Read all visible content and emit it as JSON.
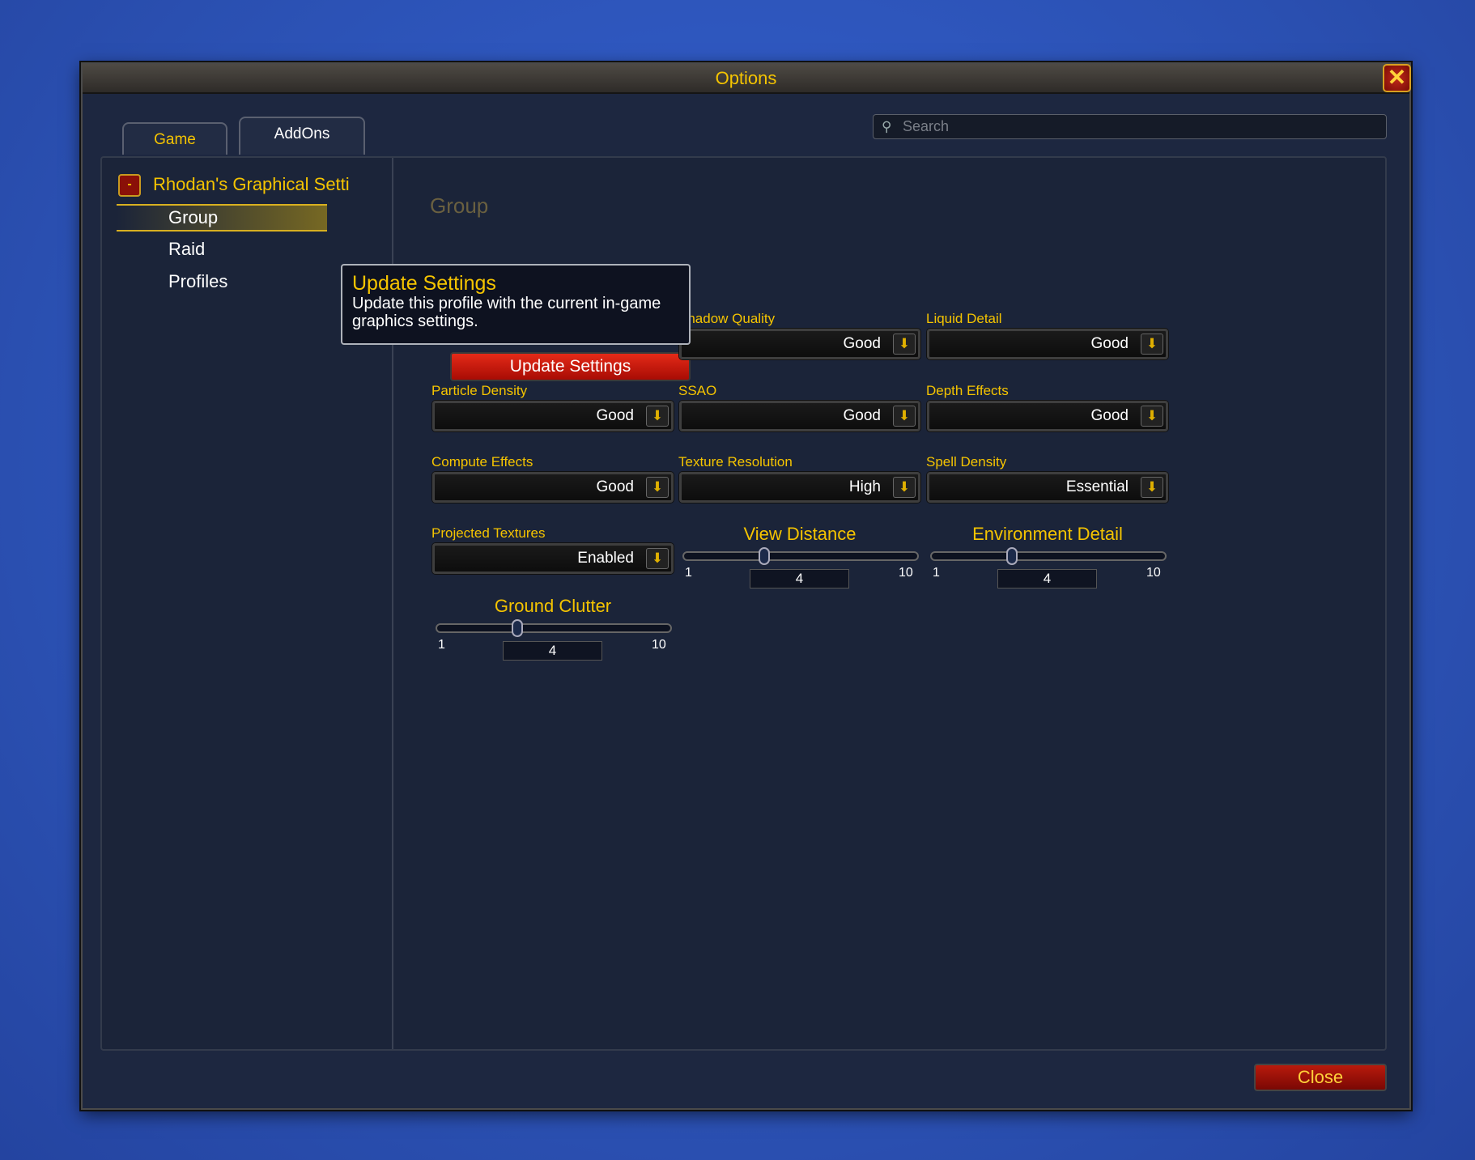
{
  "window": {
    "title": "Options",
    "close_icon": "close-x-icon"
  },
  "tabs": [
    {
      "label": "Game",
      "active": false
    },
    {
      "label": "AddOns",
      "active": true
    }
  ],
  "search": {
    "placeholder": "Search",
    "value": ""
  },
  "sidebar": {
    "root": "Rhodan's Graphical Setti",
    "items": [
      {
        "label": "Group",
        "selected": true
      },
      {
        "label": "Raid"
      },
      {
        "label": "Profiles"
      }
    ]
  },
  "tooltip": {
    "title": "Update Settings",
    "text": "Update this profile with the current in-game graphics settings."
  },
  "section_header": "Group",
  "update_button": "Update Settings",
  "dropdowns": [
    {
      "label": "Shadow Quality",
      "value": "Good"
    },
    {
      "label": "Liquid Detail",
      "value": "Good"
    },
    {
      "label": "Particle Density",
      "value": "Good"
    },
    {
      "label": "SSAO",
      "value": "Good"
    },
    {
      "label": "Depth Effects",
      "value": "Good"
    },
    {
      "label": "Compute Effects",
      "value": "Good"
    },
    {
      "label": "Texture Resolution",
      "value": "High"
    },
    {
      "label": "Spell Density",
      "value": "Essential"
    },
    {
      "label": "Projected Textures",
      "value": "Enabled"
    }
  ],
  "sliders": [
    {
      "label": "View Distance",
      "min": "1",
      "max": "10",
      "value": "4"
    },
    {
      "label": "Environment Detail",
      "min": "1",
      "max": "10",
      "value": "4"
    },
    {
      "label": "Ground Clutter",
      "min": "1",
      "max": "10",
      "value": "4"
    }
  ],
  "close_button": "Close",
  "colors": {
    "accent": "#f5c400",
    "button_red": "#c81a0c"
  }
}
